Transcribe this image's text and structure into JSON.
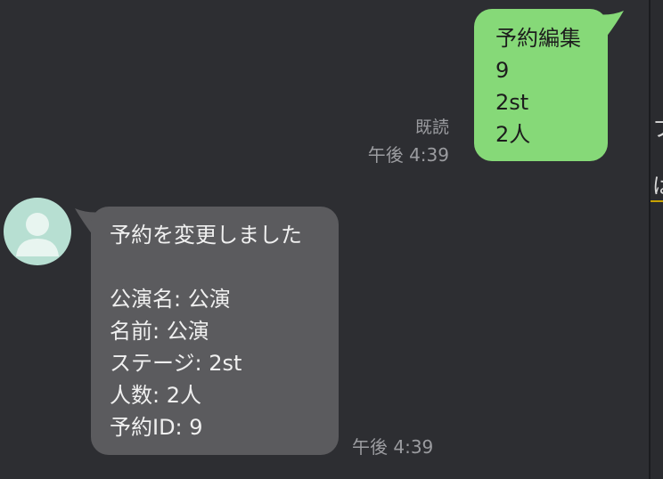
{
  "sent_message": {
    "lines": [
      "予約編集",
      "9",
      "2st",
      "2人"
    ],
    "read_label": "既読",
    "time": "午後 4:39"
  },
  "received_message": {
    "lines": [
      "予約を変更しました",
      "",
      "公演名: 公演",
      "名前: 公演",
      "ステージ: 2st",
      "人数: 2人",
      "予約ID: 9"
    ],
    "time": "午後 4:39",
    "avatar_icon": "default-user-avatar-icon"
  },
  "side_panel": {
    "glyphs": [
      "フ",
      "は"
    ]
  },
  "colors": {
    "background": "#2d2e32",
    "sent_bubble": "#86d978",
    "received_bubble": "#5b5b5e",
    "timestamp": "#9b9ca0",
    "avatar_bg": "#b7dfd2"
  }
}
